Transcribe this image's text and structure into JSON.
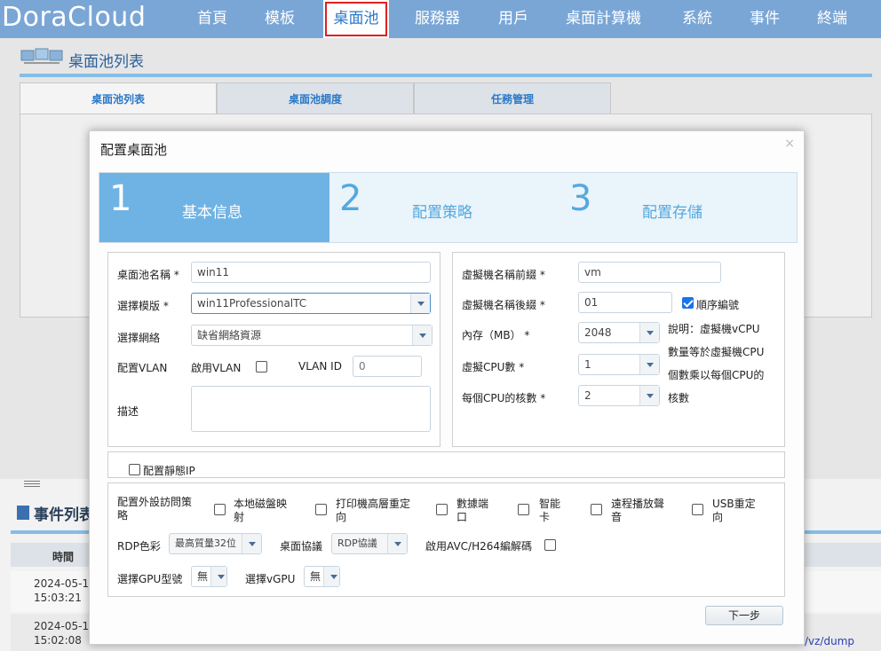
{
  "app": {
    "logo": "DoraCloud"
  },
  "nav": [
    {
      "label": "首頁"
    },
    {
      "label": "模板"
    },
    {
      "label": "桌面池"
    },
    {
      "label": "服務器"
    },
    {
      "label": "用戶"
    },
    {
      "label": "桌面計算機"
    },
    {
      "label": "系統"
    },
    {
      "label": "事件"
    },
    {
      "label": "終端"
    }
  ],
  "page": {
    "title": "桌面池列表"
  },
  "tabs": [
    {
      "label": "桌面池列表"
    },
    {
      "label": "桌面池調度"
    },
    {
      "label": "任務管理"
    }
  ],
  "events": {
    "title": "事件列表",
    "col_time": "時間",
    "rows": [
      {
        "date": "2024-05-1",
        "time": "15:03:21"
      },
      {
        "date": "2024-05-1",
        "time": "15:02:08"
      }
    ],
    "link": "/vz/dump"
  },
  "modal": {
    "title": "配置桌面池",
    "close": "×",
    "steps": [
      {
        "num": "1",
        "label": "基本信息"
      },
      {
        "num": "2",
        "label": "配置策略"
      },
      {
        "num": "3",
        "label": "配置存儲"
      }
    ],
    "left": {
      "name_label": "桌面池名稱 *",
      "name_value": "win11",
      "template_label": "選擇模版 *",
      "template_value": "win11ProfessionalTC",
      "network_label": "選擇網絡",
      "network_value": "缺省網絡資源",
      "vlan_label": "配置VLAN",
      "vlan_enable_label": "啟用VLAN",
      "vlan_id_label": "VLAN ID",
      "vlan_id_placeholder": "0",
      "desc_label": "描述"
    },
    "right": {
      "prefix_label": "虛擬機名稱前綴 *",
      "prefix_value": "vm",
      "suffix_label": "虛擬機名稱後綴 *",
      "suffix_value": "01",
      "sequential_label": "順序編號",
      "memory_label": "內存（MB） *",
      "memory_value": "2048",
      "cpu_label": "虛擬CPU數 *",
      "cpu_value": "1",
      "cores_label": "每個CPU的核數 *",
      "cores_value": "2",
      "note_lines": [
        "說明：虛擬機vCPU",
        "數量等於虛擬機CPU",
        "個數乘以每個CPU的",
        "核數"
      ]
    },
    "static_ip_label": "配置靜態IP",
    "external": {
      "policy_label": [
        "配置外設訪問策",
        "略"
      ],
      "items": [
        {
          "label": [
            "本地磁盤映",
            "射"
          ]
        },
        {
          "label": [
            "打印機高層重定",
            "向"
          ]
        },
        {
          "label": [
            "數據端",
            "口"
          ]
        },
        {
          "label": [
            "智能",
            "卡"
          ]
        },
        {
          "label": [
            "遠程播放聲",
            "音"
          ]
        },
        {
          "label": [
            "USB重定",
            "向"
          ]
        }
      ],
      "rdp_color_label": "RDP色彩",
      "rdp_color_value": "最高質量32位",
      "protocol_label": "桌面協議",
      "protocol_value": "RDP協議",
      "avc_label": "啟用AVC/H264編解碼",
      "gpu_label": "選擇GPU型號",
      "gpu_value": "無",
      "vgpu_label": "選擇vGPU",
      "vgpu_value": "無"
    },
    "next_button": "下一步"
  }
}
